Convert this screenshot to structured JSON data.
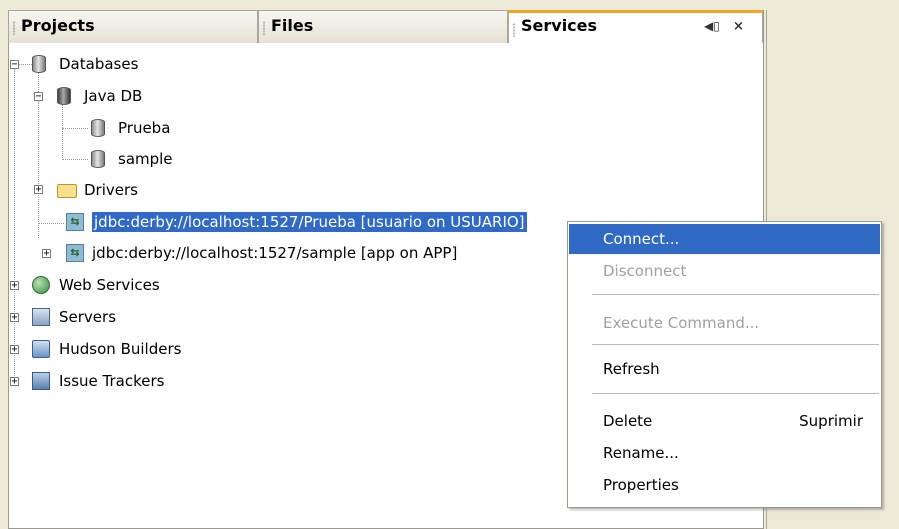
{
  "tabs": {
    "projects": "Projects",
    "files": "Files",
    "services": "Services",
    "services_minimize": "◀▯",
    "services_close": "×"
  },
  "tree": {
    "databases": "Databases",
    "java_db": "Java DB",
    "prueba": "Prueba",
    "sample": "sample",
    "drivers": "Drivers",
    "conn_prueba": "jdbc:derby://localhost:1527/Prueba [usuario on USUARIO]",
    "conn_sample": "jdbc:derby://localhost:1527/sample [app on APP]",
    "web_services": "Web Services",
    "servers": "Servers",
    "hudson": "Hudson Builders",
    "issue_trackers": "Issue Trackers"
  },
  "context_menu": {
    "connect": "Connect...",
    "disconnect": "Disconnect",
    "execute_command": "Execute Command...",
    "refresh": "Refresh",
    "delete": "Delete",
    "delete_shortcut": "Suprimir",
    "rename": "Rename...",
    "properties": "Properties"
  },
  "colors": {
    "selection": "#316ac5",
    "active_tab_accent": "#f5a623"
  }
}
